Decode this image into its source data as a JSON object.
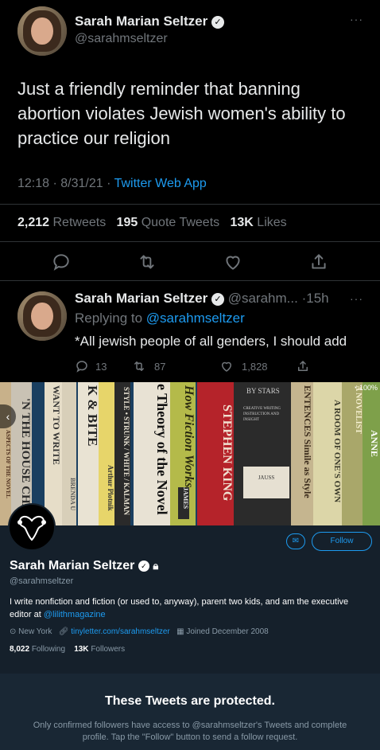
{
  "tweet": {
    "author_name": "Sarah Marian Seltzer",
    "author_handle": "@sarahmseltzer",
    "more": "···",
    "text": "Just a friendly reminder that banning abortion violates Jewish women's ability to practice our religion",
    "time": "12:18 · 8/31/21 · ",
    "source": "Twitter Web App",
    "stats": {
      "retweets_count": "2,212",
      "retweets_label": "Retweets",
      "quotes_count": "195",
      "quotes_label": "Quote Tweets",
      "likes_count": "13K",
      "likes_label": "Likes"
    },
    "actions": [
      "reply-icon",
      "retweet-icon",
      "like-icon",
      "share-icon"
    ]
  },
  "reply": {
    "author_name": "Sarah Marian Seltzer",
    "author_handle": "@sarahm...",
    "age": "·15h",
    "more": "···",
    "replying_prefix": "Replying to ",
    "replying_handle": "@sarahmseltzer",
    "text": "*All jewish people of all genders, I should add",
    "reply_count": "13",
    "retweet_count": "87",
    "like_count": "1,828"
  },
  "banner": {
    "spines": [
      "'N THE HOUSE  CHARLES BAXT",
      "ASPECTS OF THE NOVEL",
      "WANT TO WRITE",
      "BRENDA U",
      "K & BITE",
      "Arthur Plotnik",
      "STYLE • STRUNK / WHITE / KALMAN",
      "e Theory of the Novel",
      "How Fiction Works",
      "JAMES",
      "STEPHEN KING",
      "BY STARS",
      "CREATIVE WRITING INSTRUCTION AND INSIGHT",
      "JAUSS",
      "ENTENCES  Simile as Style",
      "A ROOM OF ONE'S OWN",
      "A NOVELIST",
      "ANNE"
    ],
    "status": "100%"
  },
  "profile": {
    "name": "Sarah Marian Seltzer",
    "handle": "@sarahmseltzer",
    "follow_label": "Follow",
    "bio_text": "I write nonfiction and fiction (or used to, anyway), parent two kids, and am the executive editor at ",
    "bio_link": "@lilithmagazine",
    "location": "New York",
    "website": "tinyletter.com/sarahmseltzer",
    "joined": "Joined December 2008",
    "following_count": "8,022",
    "following_label": "Following",
    "followers_count": "13K",
    "followers_label": "Followers",
    "protected_title": "These Tweets are protected.",
    "protected_text": "Only confirmed followers have access to @sarahmseltzer's Tweets and complete profile. Tap the \"Follow\" button to send a follow request."
  },
  "colors": {
    "accent": "#1d9bf0",
    "tweet_bg": "#000000",
    "profile_bg": "#15202b"
  }
}
